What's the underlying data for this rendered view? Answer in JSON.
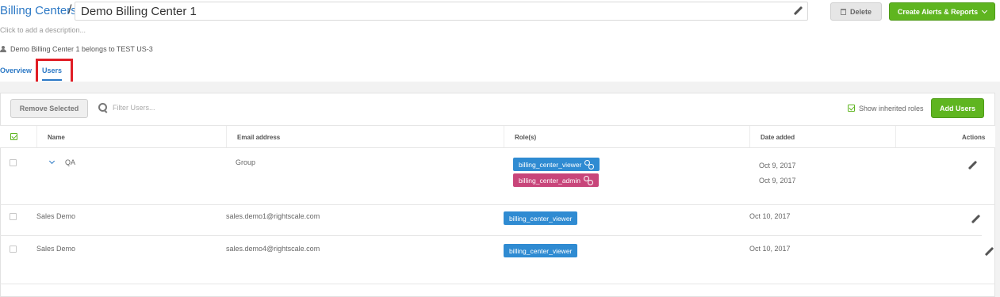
{
  "header": {
    "breadcrumb_link": "Billing Centers",
    "breadcrumb_sep": "/",
    "name_value": "Demo Billing Center 1",
    "delete_label": "Delete",
    "create_label": "Create Alerts & Reports",
    "description_placeholder": "Click to add a description...",
    "belongs_text": "Demo Billing Center 1 belongs to TEST US-3"
  },
  "tabs": [
    {
      "label": "Overview"
    },
    {
      "label": "Users"
    }
  ],
  "toolbar": {
    "remove_label": "Remove Selected",
    "filter_placeholder": "Filter Users...",
    "inherit_label": "Show inherited roles",
    "add_label": "Add Users"
  },
  "table": {
    "columns": [
      "Name",
      "Email address",
      "Role(s)",
      "Date added",
      "Actions"
    ],
    "rows": [
      {
        "name": "QA",
        "email": "Group",
        "roles": [
          "billing_center_viewer",
          "billing_center_admin"
        ],
        "dates": [
          "Oct 9, 2017",
          "Oct 9, 2017"
        ]
      },
      {
        "name": "Sales Demo",
        "email": "sales.demo1@rightscale.com",
        "roles": [
          "billing_center_viewer"
        ],
        "dates": [
          "Oct 10, 2017"
        ]
      },
      {
        "name": "Sales Demo",
        "email": "sales.demo4@rightscale.com",
        "roles": [
          "billing_center_viewer"
        ],
        "dates": [
          "Oct 10, 2017"
        ]
      }
    ]
  },
  "colors": {
    "link": "#2b78c5",
    "green": "#5fb520",
    "role_viewer": "#2f8bd2",
    "role_admin": "#c8457a",
    "highlight": "#e01e26"
  }
}
